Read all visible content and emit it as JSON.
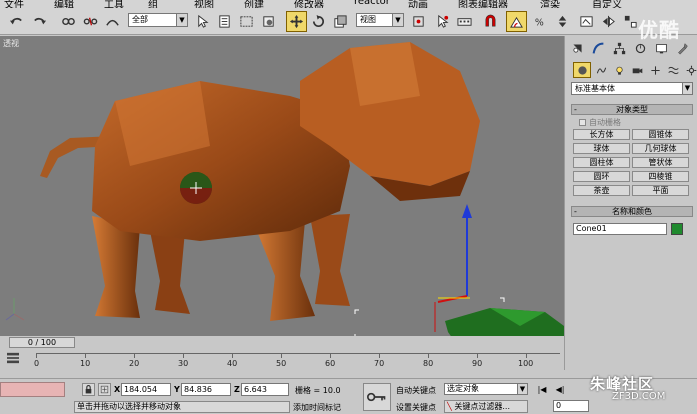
{
  "menu": [
    "文件",
    "编辑",
    "工具",
    "组",
    "视图",
    "创建",
    "修改器",
    "reactor",
    "动画",
    "图表编辑器",
    "渲染",
    "自定义"
  ],
  "toolbar": {
    "filter_select": "全部",
    "ref_coord_select": "视图"
  },
  "viewport": {
    "label": "透视"
  },
  "command_panel": {
    "category_select": "标准基本体",
    "object_type_title": "对象类型",
    "autogrid_label": "自动栅格",
    "object_buttons": [
      "长方体",
      "圆锥体",
      "球体",
      "几何球体",
      "圆柱体",
      "管状体",
      "圆环",
      "四棱锥",
      "茶壶",
      "平面"
    ],
    "name_color_title": "名称和颜色",
    "object_name": "Cone01",
    "object_color": "#1f8a2e"
  },
  "timeline": {
    "slider_label": "0 / 100",
    "ticks": [
      "0",
      "10",
      "20",
      "30",
      "40",
      "50",
      "60",
      "70",
      "80",
      "90",
      "100"
    ]
  },
  "status": {
    "x_label": "X",
    "x_value": "184.054",
    "y_label": "Y",
    "y_value": "84.836",
    "z_label": "Z",
    "z_value": "6.643",
    "grid_text": "栅格 = 10.0",
    "prompt": "单击并拖动以选择并移动对象",
    "add_time_tag": "添加时间标记",
    "auto_key": "自动关键点",
    "set_key": "设置关键点",
    "selection_set": "选定对象",
    "key_filters": "关键点过滤器...",
    "current_frame": "0"
  },
  "watermarks": {
    "top_right": "优酷",
    "bottom_right": "朱峰社区",
    "bottom_right_url": "ZF3D.COM"
  }
}
